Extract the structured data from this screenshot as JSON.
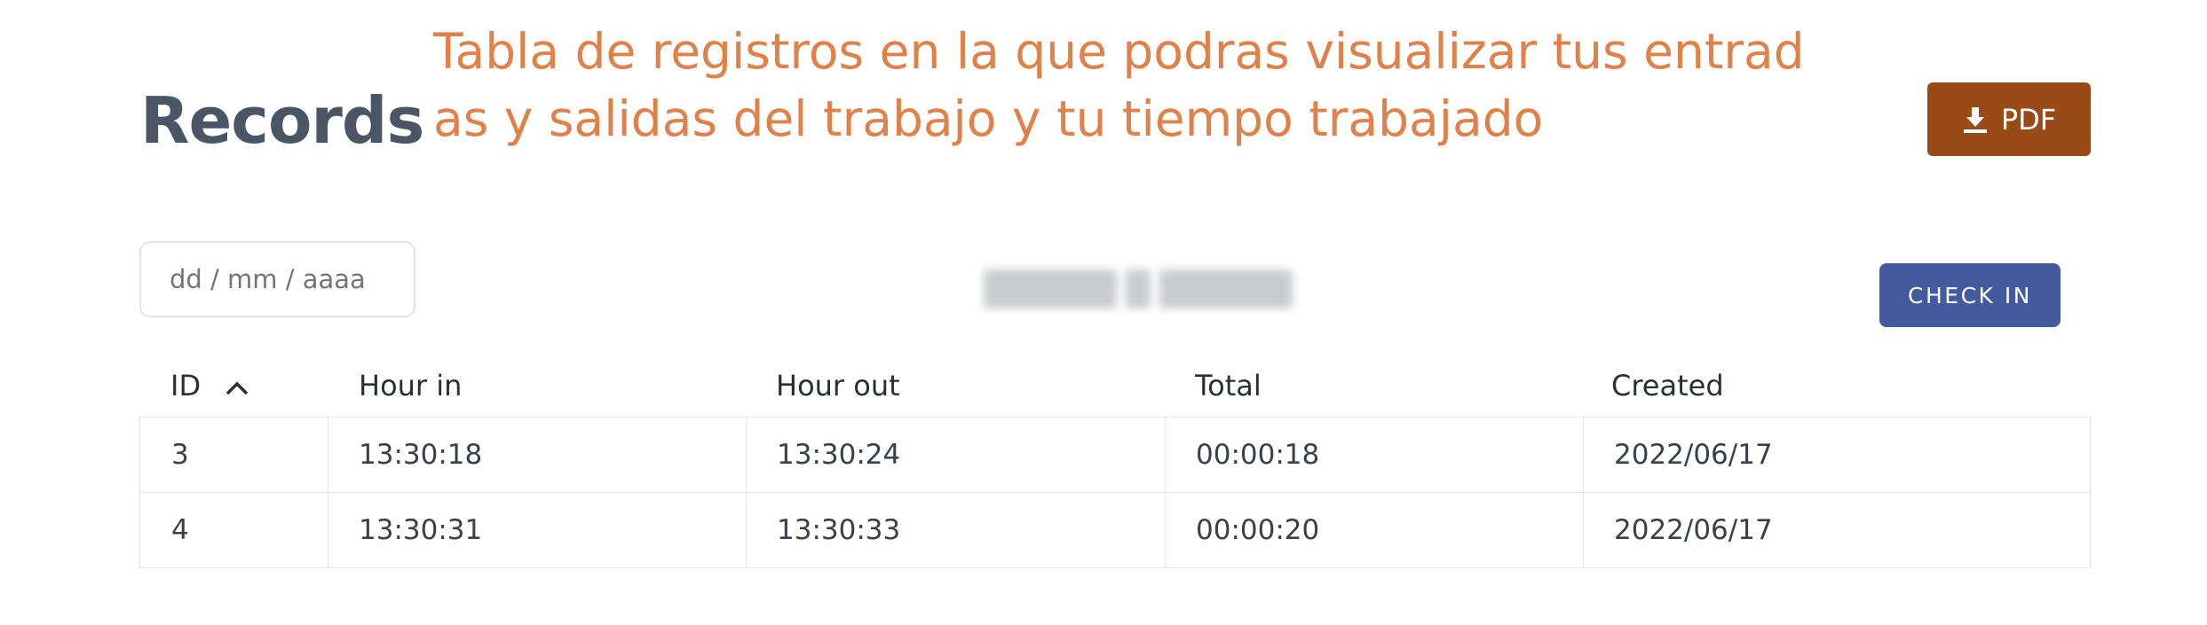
{
  "page": {
    "title": "Records",
    "annotation": "Tabla de registros en la que podras visualizar tus entradas y salidas del trabajo y tu tiempo trabajado"
  },
  "toolbar": {
    "pdf_label": "PDF",
    "pdf_icon": "download-icon",
    "date_placeholder": "dd / mm / aaaa",
    "check_in_label": "CHECK IN"
  },
  "colors": {
    "annotation": "#e0814a",
    "pdf_button": "#9a4a17",
    "check_in_button": "#435a9e",
    "title": "#4a5565"
  },
  "table": {
    "columns": [
      {
        "label": "ID",
        "sort": "ascending"
      },
      {
        "label": "Hour in"
      },
      {
        "label": "Hour out"
      },
      {
        "label": "Total"
      },
      {
        "label": "Created"
      }
    ],
    "rows": [
      [
        "3",
        "13:30:18",
        "13:30:24",
        "00:00:18",
        "2022/06/17"
      ],
      [
        "4",
        "13:30:31",
        "13:30:33",
        "00:00:20",
        "2022/06/17"
      ]
    ]
  }
}
